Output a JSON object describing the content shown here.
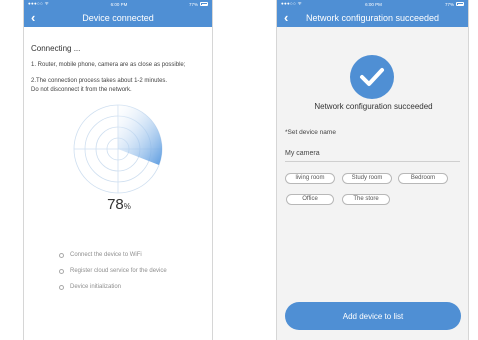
{
  "colors": {
    "accent": "#4f8fd4",
    "radar_fill": "#5b9be0"
  },
  "statusbar": {
    "time": "6:00 PM",
    "battery": "77%"
  },
  "left": {
    "title": "Device connected",
    "connecting": "Connecting ...",
    "note1": "1. Router, mobile phone, camera are as close as possible;",
    "note2": "2.The connection process takes about 1-2 minutes.",
    "note3": "Do not disconnect it from the network.",
    "progress": {
      "value": 78,
      "unit": "%"
    },
    "steps": [
      "Connect the device to WiFi",
      "Register cloud service for the device",
      "Device initialization"
    ]
  },
  "right": {
    "title": "Network configuration succeeded",
    "success_text": "Network configuration succeeded",
    "set_name_label": "*Set device name",
    "name_value": "My camera",
    "chips": [
      "living room",
      "Study room",
      "Bedroom",
      "Office",
      "The store"
    ],
    "add_button": "Add device to list"
  },
  "icons": {
    "back": "chevron-left-icon",
    "check": "checkmark-icon",
    "radar": "radar-icon",
    "step": "circle-outline-icon"
  }
}
